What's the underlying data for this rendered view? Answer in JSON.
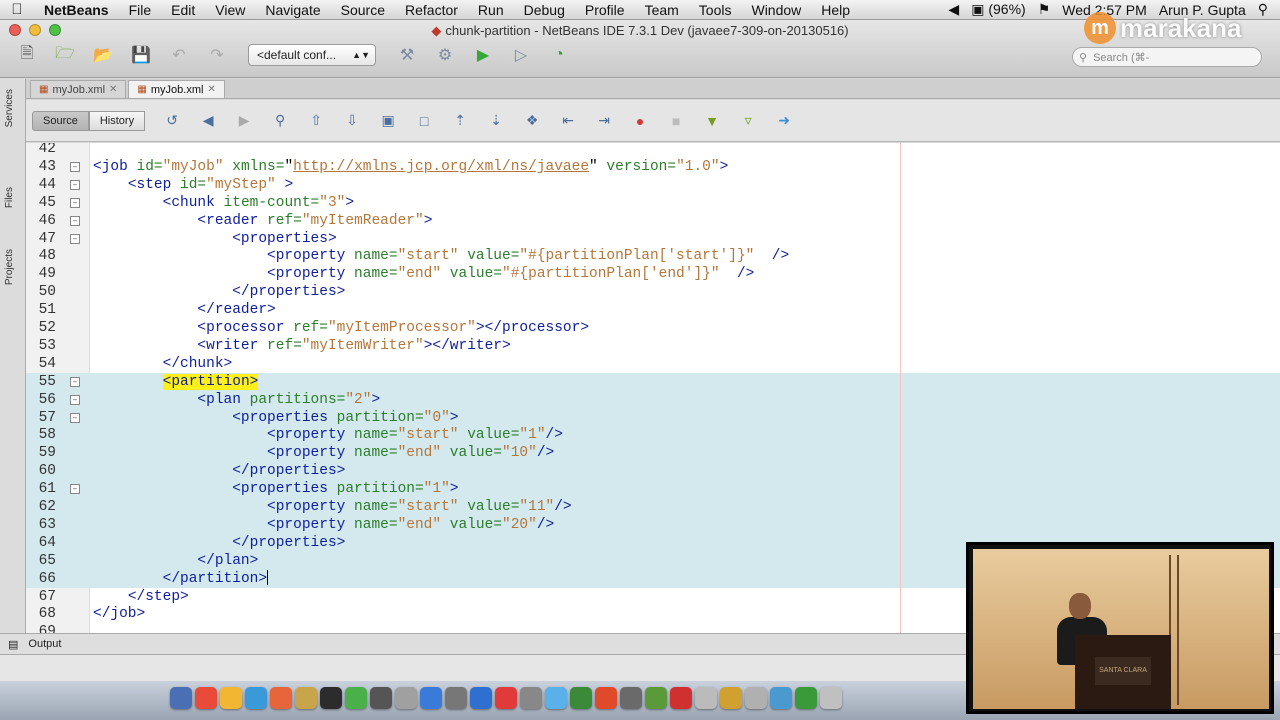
{
  "menubar": {
    "app": "NetBeans",
    "items": [
      "File",
      "Edit",
      "View",
      "Navigate",
      "Source",
      "Refactor",
      "Run",
      "Debug",
      "Profile",
      "Team",
      "Tools",
      "Window",
      "Help"
    ],
    "battery": "(96%)",
    "clock": "Wed 2:57 PM",
    "user": "Arun P. Gupta"
  },
  "window": {
    "title": "chunk-partition - NetBeans IDE 7.3.1 Dev (javaee7-309-on-20130516)",
    "config_select": "<default conf...",
    "search_placeholder": "Search (⌘-"
  },
  "logo": {
    "text": "marakana",
    "mark": "m"
  },
  "side_tabs": [
    "Services",
    "Files",
    "Projects"
  ],
  "editor_tabs": [
    {
      "label": "myJob.xml",
      "active": false
    },
    {
      "label": "myJob.xml",
      "active": true
    }
  ],
  "editor_toolbar": {
    "source": "Source",
    "history": "History"
  },
  "editor_lines": [
    {
      "num": "42",
      "code": ""
    },
    {
      "num": "43",
      "code": "<job id=\"myJob\" xmlns=\"http://xmlns.jcp.org/xml/ns/javaee\" version=\"1.0\">"
    },
    {
      "num": "44",
      "code": "    <step id=\"myStep\" >"
    },
    {
      "num": "45",
      "code": "        <chunk item-count=\"3\">"
    },
    {
      "num": "46",
      "code": "            <reader ref=\"myItemReader\">"
    },
    {
      "num": "47",
      "code": "                <properties>"
    },
    {
      "num": "48",
      "code": "                    <property name=\"start\" value=\"#{partitionPlan['start']}\"  />"
    },
    {
      "num": "49",
      "code": "                    <property name=\"end\" value=\"#{partitionPlan['end']}\"  />"
    },
    {
      "num": "50",
      "code": "                </properties>"
    },
    {
      "num": "51",
      "code": "            </reader>"
    },
    {
      "num": "52",
      "code": "            <processor ref=\"myItemProcessor\"></processor>"
    },
    {
      "num": "53",
      "code": "            <writer ref=\"myItemWriter\"></writer>"
    },
    {
      "num": "54",
      "code": "        </chunk>"
    },
    {
      "num": "55",
      "code": "        <partition>"
    },
    {
      "num": "56",
      "code": "            <plan partitions=\"2\">"
    },
    {
      "num": "57",
      "code": "                <properties partition=\"0\">"
    },
    {
      "num": "58",
      "code": "                    <property name=\"start\" value=\"1\"/>"
    },
    {
      "num": "59",
      "code": "                    <property name=\"end\" value=\"10\"/>"
    },
    {
      "num": "60",
      "code": "                </properties>"
    },
    {
      "num": "61",
      "code": "                <properties partition=\"1\">"
    },
    {
      "num": "62",
      "code": "                    <property name=\"start\" value=\"11\"/>"
    },
    {
      "num": "63",
      "code": "                    <property name=\"end\" value=\"20\"/>"
    },
    {
      "num": "64",
      "code": "                </properties>"
    },
    {
      "num": "65",
      "code": "            </plan>"
    },
    {
      "num": "66",
      "code": "        </partition>"
    },
    {
      "num": "67",
      "code": "    </step>"
    },
    {
      "num": "68",
      "code": "</job>"
    },
    {
      "num": "69",
      "code": ""
    }
  ],
  "selected_lines": [
    55,
    66
  ],
  "folds": [
    "43",
    "44",
    "45",
    "46",
    "47",
    "55",
    "56",
    "57",
    "61"
  ],
  "output_label": "Output",
  "video": {
    "podium_sign": "SANTA CLARA"
  },
  "colors": {
    "selection": "#d3e9ee",
    "tag": "#0f1f9c",
    "attribute": "#2c7d2c",
    "value": "#b5763a",
    "tag_highlight": "#ffef1a",
    "brand_orange": "#f0902c"
  }
}
